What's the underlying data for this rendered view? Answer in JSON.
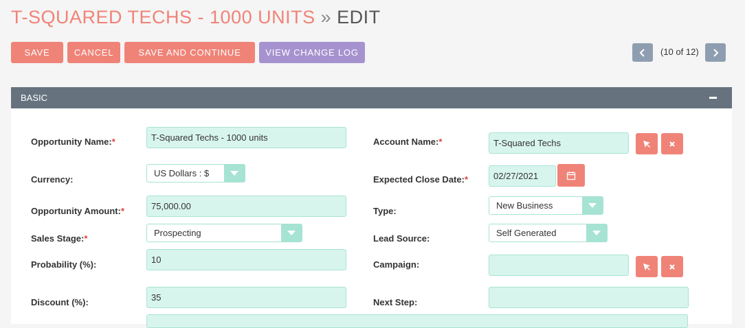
{
  "header": {
    "record_title": "T-SQUARED TECHS - 1000 UNITS",
    "separator": "»",
    "action": "EDIT"
  },
  "toolbar": {
    "save_label": "SAVE",
    "cancel_label": "CANCEL",
    "save_continue_label": "SAVE AND CONTINUE",
    "change_log_label": "VIEW CHANGE LOG"
  },
  "pagination": {
    "text": "(10 of 12)"
  },
  "panel": {
    "title": "BASIC"
  },
  "fields": {
    "opportunity_name": {
      "label": "Opportunity Name:",
      "required": "*",
      "value": "T-Squared Techs - 1000 units"
    },
    "account_name": {
      "label": "Account Name:",
      "required": "*",
      "value": "T-Squared Techs"
    },
    "currency": {
      "label": "Currency:",
      "value": "US Dollars : $"
    },
    "expected_close_date": {
      "label": "Expected Close Date:",
      "required": "*",
      "value": "02/27/2021"
    },
    "opportunity_amount": {
      "label": "Opportunity Amount:",
      "required": "*",
      "value": "75,000.00"
    },
    "type": {
      "label": "Type:",
      "value": "New Business"
    },
    "sales_stage": {
      "label": "Sales Stage:",
      "required": "*",
      "value": "Prospecting"
    },
    "lead_source": {
      "label": "Lead Source:",
      "value": "Self Generated"
    },
    "probability": {
      "label": "Probability (%):",
      "value": "10"
    },
    "campaign": {
      "label": "Campaign:",
      "value": ""
    },
    "discount": {
      "label": "Discount (%):",
      "value": "35"
    },
    "next_step": {
      "label": "Next Step:",
      "value": ""
    }
  },
  "colors": {
    "accent": "#f08377",
    "purple": "#a592cf",
    "field_bg": "#d8f5ed",
    "panel_header": "#66737f"
  },
  "icons": [
    "arrow-left-icon",
    "arrow-right-icon",
    "minus-icon",
    "select-arrow-icon",
    "clear-x-icon",
    "calendar-icon",
    "chevron-down-icon"
  ]
}
